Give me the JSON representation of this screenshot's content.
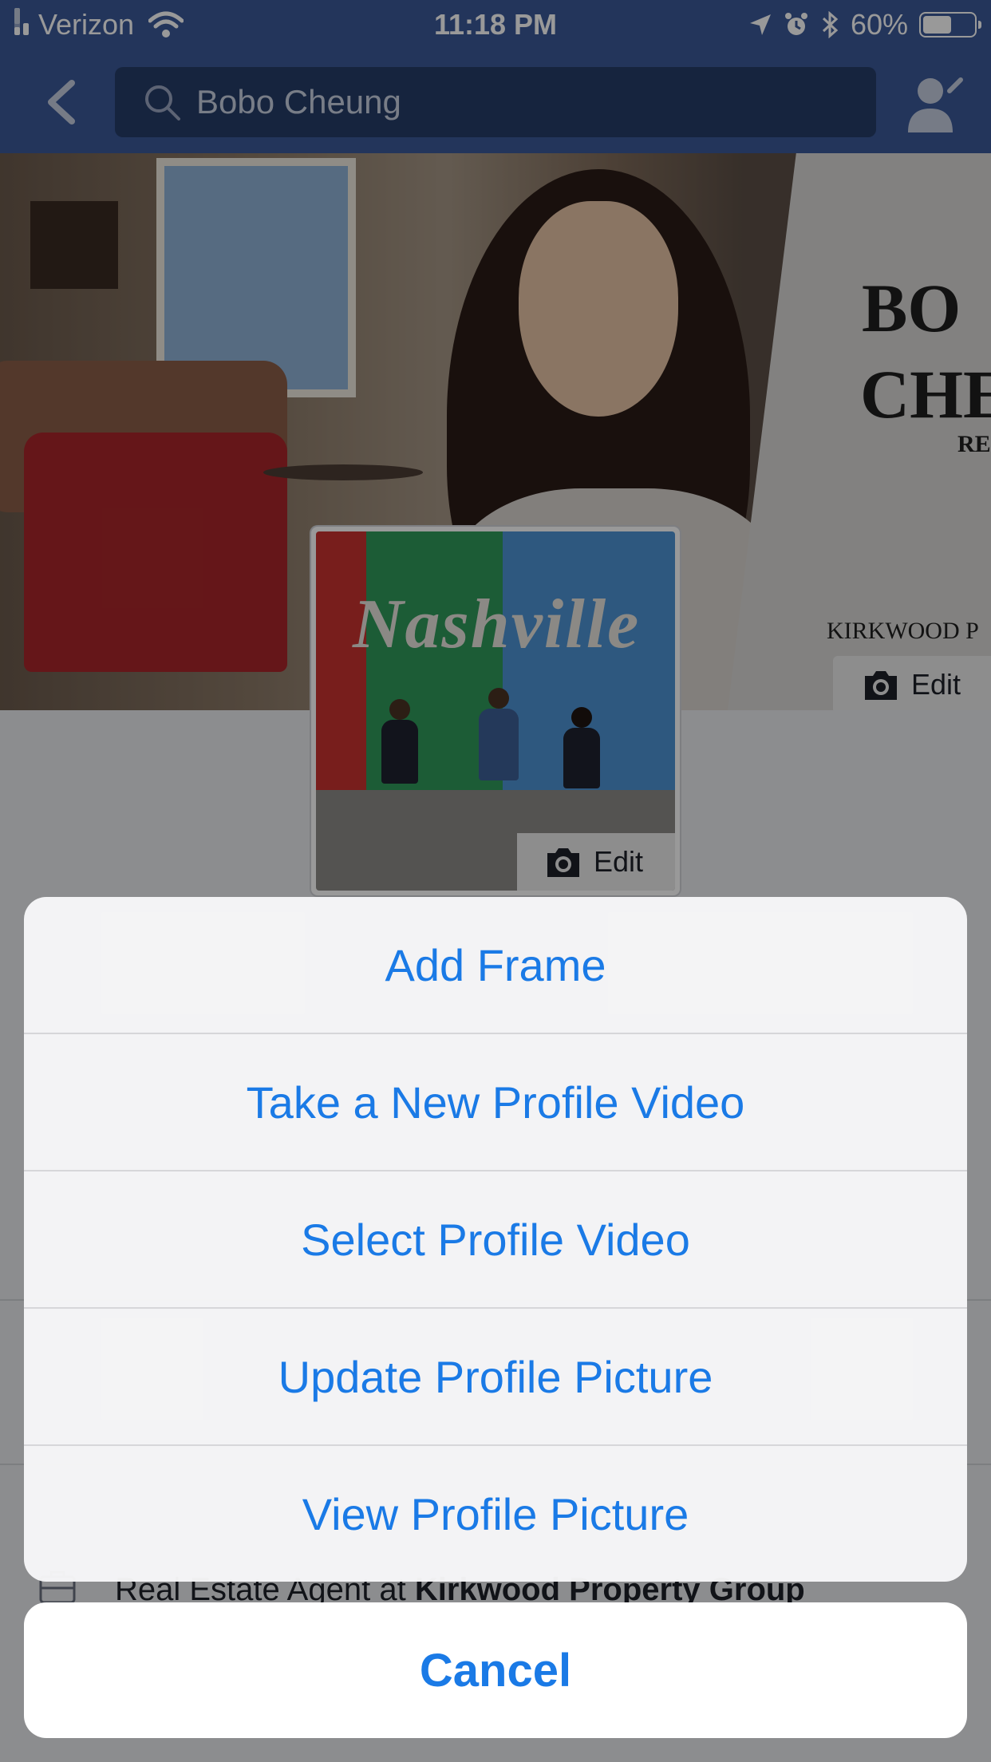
{
  "status_bar": {
    "carrier": "Verizon",
    "time": "11:18 PM",
    "battery": "60%",
    "battery_level": 0.6
  },
  "nav": {
    "search_value": "Bobo Cheung"
  },
  "cover": {
    "title_line1": "BO",
    "title_line2": "CHE",
    "subtitle": "RE",
    "firm": "KIRKWOOD P",
    "edit_label": "Edit"
  },
  "profile_picture": {
    "word": "Nashville",
    "edit_label": "Edit"
  },
  "job": {
    "prefix": "Real Estate Agent at ",
    "company": "Kirkwood Property Group"
  },
  "action_sheet": {
    "items": [
      "Add Frame",
      "Take a New Profile Video",
      "Select Profile Video",
      "Update Profile Picture",
      "View Profile Picture"
    ],
    "cancel": "Cancel"
  },
  "colors": {
    "facebook_blue": "#3b5998",
    "ios_action_blue": "#1a7ae6"
  }
}
